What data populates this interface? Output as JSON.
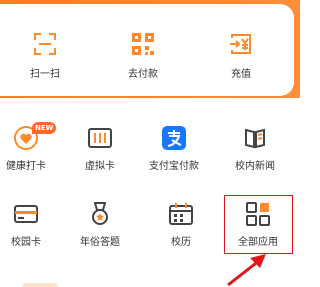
{
  "colors": {
    "accent": "#ff8a2b",
    "highlight": "#e0141b",
    "alipay": "#1677ff"
  },
  "quick_actions": [
    {
      "label": "扫一扫",
      "icon": "scan-icon"
    },
    {
      "label": "去付款",
      "icon": "payment-code-icon"
    },
    {
      "label": "充值",
      "icon": "recharge-icon"
    }
  ],
  "apps": [
    {
      "label": "健康打卡",
      "icon": "health-checkin-icon",
      "badge": "NEW"
    },
    {
      "label": "虚拟卡",
      "icon": "virtual-card-icon"
    },
    {
      "label": "支付宝付款",
      "icon": "alipay-icon"
    },
    {
      "label": "校内新闻",
      "icon": "campus-news-icon"
    },
    {
      "label": "校园卡",
      "icon": "campus-card-icon"
    },
    {
      "label": "年俗答题",
      "icon": "quiz-medal-icon"
    },
    {
      "label": "校历",
      "icon": "calendar-icon"
    },
    {
      "label": "全部应用",
      "icon": "all-apps-icon"
    }
  ]
}
